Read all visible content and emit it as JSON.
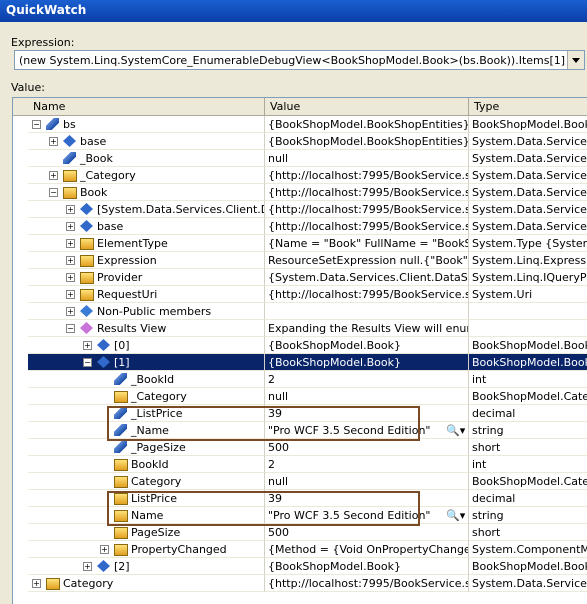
{
  "window": {
    "title": "QuickWatch"
  },
  "expression": {
    "label": "Expression:",
    "value": "(new System.Linq.SystemCore_EnumerableDebugView<BookShopModel.Book>(bs.Book)).Items[1]"
  },
  "value_label": "Value:",
  "columns": {
    "name": "Name",
    "value": "Value",
    "type": "Type"
  },
  "rows": [
    {
      "name": "bs",
      "value": "{BookShopModel.BookShopEntities}",
      "type": "BookShopModel.BookSho"
    },
    {
      "name": "base",
      "value": "{BookShopModel.BookShopEntities}",
      "type": "System.Data.Services.C"
    },
    {
      "name": "_Book",
      "value": "null",
      "type": "System.Data.Services.C"
    },
    {
      "name": "_Category",
      "value": "{http://localhost:7995/BookService.svc/Ca",
      "type": "System.Data.Services.C"
    },
    {
      "name": "Book",
      "value": "{http://localhost:7995/BookService.svc/Bo",
      "type": "System.Data.Services.C"
    },
    {
      "name": "[System.Data.Services.Client.Dat",
      "value": "{http://localhost:7995/BookService.svc/Bo",
      "type": "System.Data.Services.C"
    },
    {
      "name": "base",
      "value": "{http://localhost:7995/BookService.svc/Bo",
      "type": "System.Data.Services.C"
    },
    {
      "name": "ElementType",
      "value": "{Name = \"Book\" FullName = \"BookShopMo",
      "type": "System.Type {System.R"
    },
    {
      "name": "Expression",
      "value": "ResourceSetExpression null.{\"Book\"}",
      "type": "System.Linq.Expression"
    },
    {
      "name": "Provider",
      "value": "{System.Data.Services.Client.DataService",
      "type": "System.Linq.IQueryProv"
    },
    {
      "name": "RequestUri",
      "value": "{http://localhost:7995/BookService.svc/Bo",
      "type": "System.Uri"
    },
    {
      "name": "Non-Public members",
      "value": "",
      "type": ""
    },
    {
      "name": "Results View",
      "value": "Expanding the Results View will enumerate",
      "type": ""
    },
    {
      "name": "[0]",
      "value": "{BookShopModel.Book}",
      "type": "BookShopModel.Book"
    },
    {
      "name": "[1]",
      "value": "{BookShopModel.Book}",
      "type": "BookShopModel.Book"
    },
    {
      "name": "_BookId",
      "value": "2",
      "type": "int"
    },
    {
      "name": "_Category",
      "value": "null",
      "type": "BookShopModel.Catego"
    },
    {
      "name": "_ListPrice",
      "value": "39",
      "type": "decimal"
    },
    {
      "name": "_Name",
      "value": "\"Pro WCF 3.5 Second Edition\"",
      "type": "string"
    },
    {
      "name": "_PageSize",
      "value": "500",
      "type": "short"
    },
    {
      "name": "BookId",
      "value": "2",
      "type": "int"
    },
    {
      "name": "Category",
      "value": "null",
      "type": "BookShopModel.Catego"
    },
    {
      "name": "ListPrice",
      "value": "39",
      "type": "decimal"
    },
    {
      "name": "Name",
      "value": "\"Pro WCF 3.5 Second Edition\"",
      "type": "string"
    },
    {
      "name": "PageSize",
      "value": "500",
      "type": "short"
    },
    {
      "name": "PropertyChanged",
      "value": "{Method = {Void OnPropertyChanged(Sys",
      "type": "System.ComponentMode"
    },
    {
      "name": "[2]",
      "value": "{BookShopModel.Book}",
      "type": "BookShopModel.Book"
    },
    {
      "name": "Category",
      "value": "{http://localhost:7995/BookService.svc/Ca",
      "type": "System.Data.Services.C"
    }
  ],
  "selected_row": "[1]"
}
